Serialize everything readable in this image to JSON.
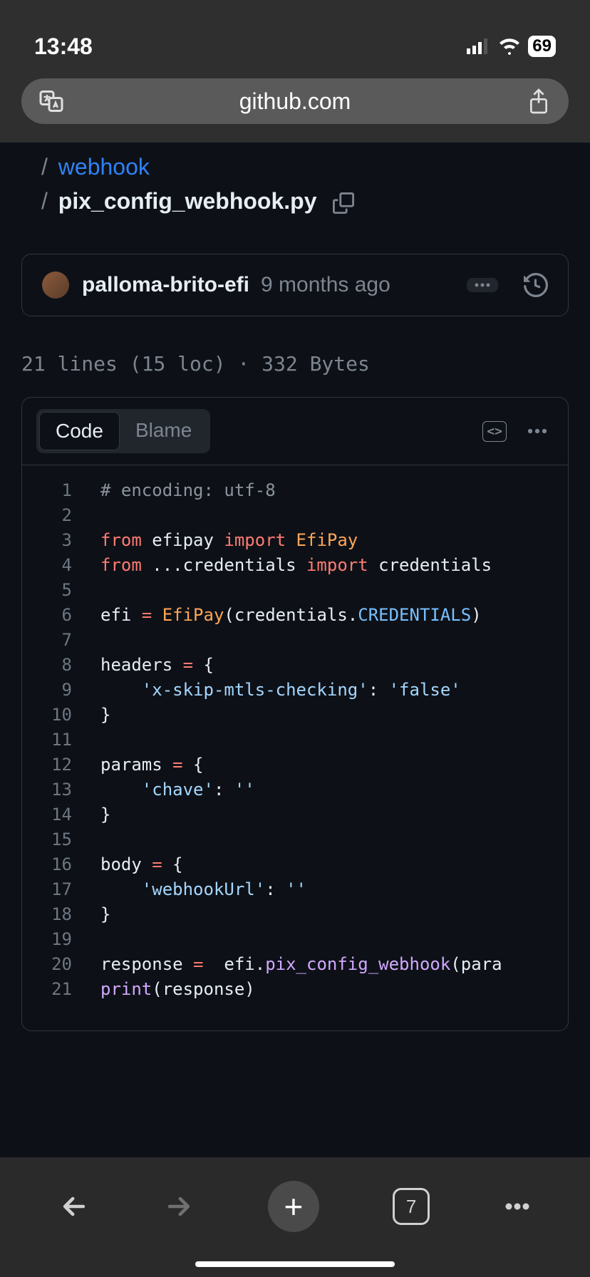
{
  "status": {
    "time": "13:48",
    "battery": "69"
  },
  "browser": {
    "url": "github.com",
    "tab_count": "7"
  },
  "breadcrumb": {
    "parent": "webhook",
    "current": "pix_config_webhook.py"
  },
  "commit": {
    "author": "palloma-brito-efi",
    "time": "9 months ago"
  },
  "file_stats": "21 lines (15 loc) · 332 Bytes",
  "tabs": {
    "code": "Code",
    "blame": "Blame"
  },
  "code_lines": [
    {
      "n": "1",
      "segs": [
        {
          "t": "# encoding: utf-8",
          "c": "c-comment"
        }
      ]
    },
    {
      "n": "2",
      "segs": []
    },
    {
      "n": "3",
      "segs": [
        {
          "t": "from",
          "c": "c-kw"
        },
        {
          "t": " efipay "
        },
        {
          "t": "import",
          "c": "c-kw"
        },
        {
          "t": " "
        },
        {
          "t": "EfiPay",
          "c": "c-cls"
        }
      ]
    },
    {
      "n": "4",
      "segs": [
        {
          "t": "from",
          "c": "c-kw"
        },
        {
          "t": " ...credentials "
        },
        {
          "t": "import",
          "c": "c-kw"
        },
        {
          "t": " credentials"
        }
      ]
    },
    {
      "n": "5",
      "segs": []
    },
    {
      "n": "6",
      "segs": [
        {
          "t": "efi "
        },
        {
          "t": "=",
          "c": "c-kw"
        },
        {
          "t": " "
        },
        {
          "t": "EfiPay",
          "c": "c-cls"
        },
        {
          "t": "(credentials."
        },
        {
          "t": "CREDENTIALS",
          "c": "c-const"
        },
        {
          "t": ")"
        }
      ]
    },
    {
      "n": "7",
      "segs": []
    },
    {
      "n": "8",
      "segs": [
        {
          "t": "headers "
        },
        {
          "t": "=",
          "c": "c-kw"
        },
        {
          "t": " {"
        }
      ]
    },
    {
      "n": "9",
      "segs": [
        {
          "t": "    "
        },
        {
          "t": "'x-skip-mtls-checking'",
          "c": "c-str"
        },
        {
          "t": ": "
        },
        {
          "t": "'false'",
          "c": "c-str"
        }
      ]
    },
    {
      "n": "10",
      "segs": [
        {
          "t": "}"
        }
      ]
    },
    {
      "n": "11",
      "segs": []
    },
    {
      "n": "12",
      "segs": [
        {
          "t": "params "
        },
        {
          "t": "=",
          "c": "c-kw"
        },
        {
          "t": " {"
        }
      ]
    },
    {
      "n": "13",
      "segs": [
        {
          "t": "    "
        },
        {
          "t": "'chave'",
          "c": "c-str"
        },
        {
          "t": ": "
        },
        {
          "t": "''",
          "c": "c-str"
        }
      ]
    },
    {
      "n": "14",
      "segs": [
        {
          "t": "}"
        }
      ]
    },
    {
      "n": "15",
      "segs": []
    },
    {
      "n": "16",
      "segs": [
        {
          "t": "body "
        },
        {
          "t": "=",
          "c": "c-kw"
        },
        {
          "t": " {"
        }
      ]
    },
    {
      "n": "17",
      "segs": [
        {
          "t": "    "
        },
        {
          "t": "'webhookUrl'",
          "c": "c-str"
        },
        {
          "t": ": "
        },
        {
          "t": "''",
          "c": "c-str"
        }
      ]
    },
    {
      "n": "18",
      "segs": [
        {
          "t": "}"
        }
      ]
    },
    {
      "n": "19",
      "segs": []
    },
    {
      "n": "20",
      "segs": [
        {
          "t": "response "
        },
        {
          "t": "=",
          "c": "c-kw"
        },
        {
          "t": "  efi."
        },
        {
          "t": "pix_config_webhook",
          "c": "c-fn"
        },
        {
          "t": "(para"
        }
      ]
    },
    {
      "n": "21",
      "segs": [
        {
          "t": "print",
          "c": "c-fn"
        },
        {
          "t": "(response)"
        }
      ]
    }
  ]
}
